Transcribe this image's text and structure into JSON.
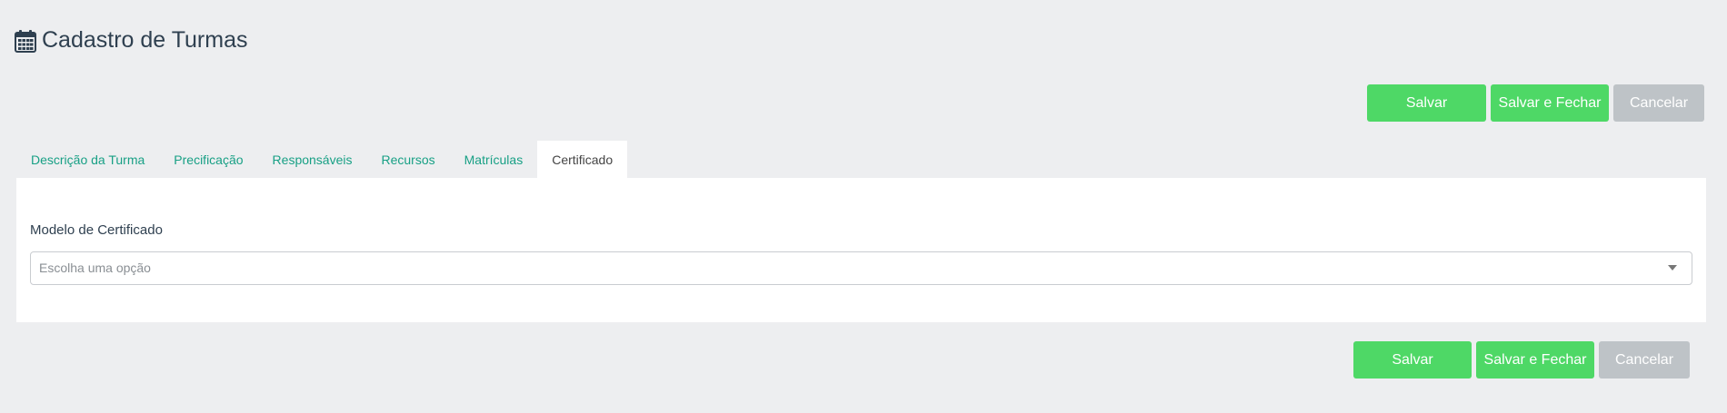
{
  "header": {
    "title": "Cadastro de Turmas",
    "icon": "calendar-icon"
  },
  "actions_top": {
    "save_label": "Salvar",
    "save_close_label": "Salvar e Fechar",
    "cancel_label": "Cancelar"
  },
  "tabs": [
    {
      "label": "Descrição da Turma"
    },
    {
      "label": "Precificação"
    },
    {
      "label": "Responsáveis"
    },
    {
      "label": "Recursos"
    },
    {
      "label": "Matrículas"
    },
    {
      "label": "Certificado",
      "active": true
    }
  ],
  "form": {
    "certificate_model_label": "Modelo de Certificado",
    "certificate_model_placeholder": "Escolha uma opção",
    "certificate_model_value": ""
  },
  "actions_bottom": {
    "save_label": "Salvar",
    "save_close_label": "Salvar e Fechar",
    "cancel_label": "Cancelar"
  },
  "colors": {
    "background": "#edeef0",
    "primary_green": "#4ed866",
    "cancel_gray": "#bec3c7",
    "tab_link": "#18a085",
    "title_text": "#2f4050"
  }
}
